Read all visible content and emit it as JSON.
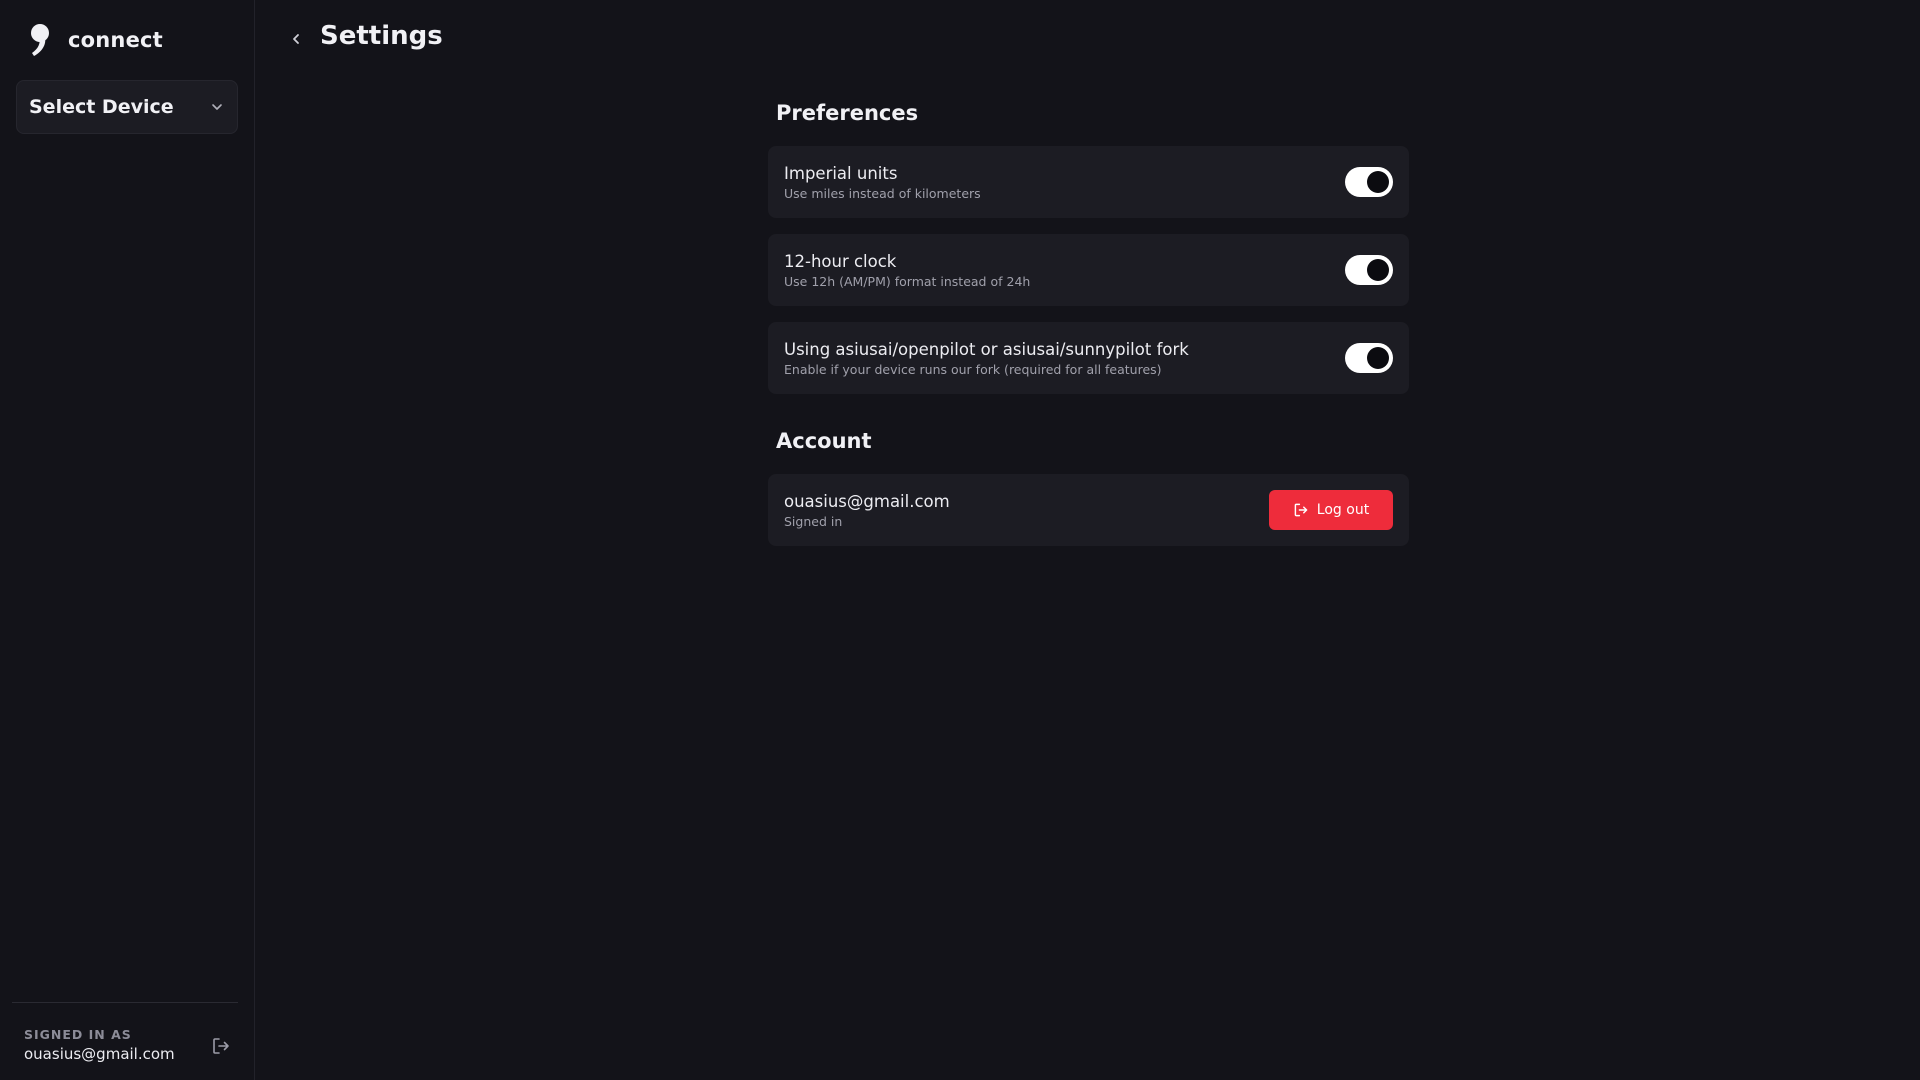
{
  "brand": {
    "name": "connect",
    "logo_icon": "comma-logo-icon"
  },
  "device_select": {
    "label": "Select Device",
    "icon": "chevron-down-icon"
  },
  "sidebar_footer": {
    "signed_in_label": "SIGNED IN AS",
    "email": "ouasius@gmail.com",
    "logout_icon": "logout-icon"
  },
  "header": {
    "title": "Settings",
    "back_icon": "chevron-left-icon"
  },
  "preferences": {
    "heading": "Preferences",
    "items": [
      {
        "title": "Imperial units",
        "description": "Use miles instead of kilometers",
        "enabled": true
      },
      {
        "title": "12-hour clock",
        "description": "Use 12h (AM/PM) format instead of 24h",
        "enabled": true
      },
      {
        "title": "Using asiusai/openpilot or asiusai/sunnypilot fork",
        "description": "Enable if your device runs our fork (required for all features)",
        "enabled": true
      }
    ]
  },
  "account": {
    "heading": "Account",
    "email": "ouasius@gmail.com",
    "status": "Signed in",
    "logout_label": "Log out"
  },
  "colors": {
    "background": "#131319",
    "card": "#1c1c23",
    "accent_danger": "#ee2c3b",
    "toggle_on": "#ffffff"
  }
}
